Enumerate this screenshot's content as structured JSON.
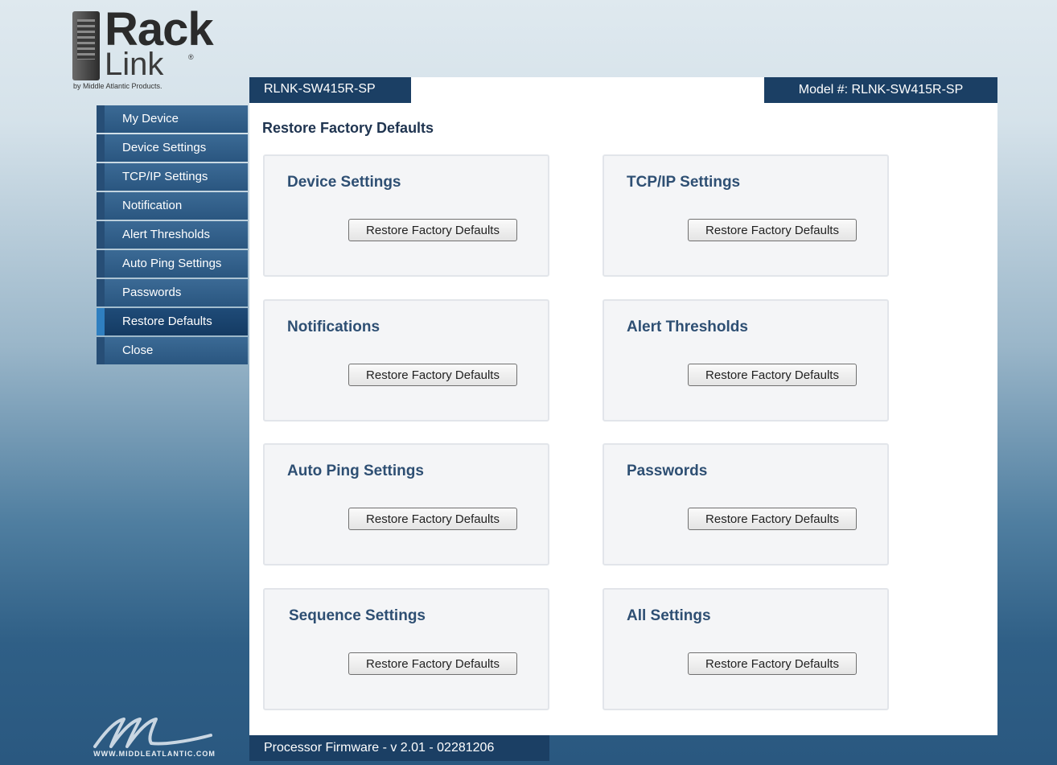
{
  "logo": {
    "rack": "Rack",
    "link": "Link",
    "registered": "®",
    "byline": "by Middle Atlantic Products."
  },
  "sidebar": {
    "items": [
      {
        "label": "My Device"
      },
      {
        "label": "Device Settings"
      },
      {
        "label": "TCP/IP Settings"
      },
      {
        "label": "Notification"
      },
      {
        "label": "Alert Thresholds"
      },
      {
        "label": "Auto Ping Settings"
      },
      {
        "label": "Passwords"
      },
      {
        "label": "Restore Defaults",
        "active": true
      },
      {
        "label": "Close"
      }
    ]
  },
  "header": {
    "device_name": "RLNK-SW415R-SP",
    "model_label": "Model #: RLNK-SW415R-SP"
  },
  "main": {
    "page_title": "Restore Factory Defaults",
    "cards": [
      {
        "title": "Device Settings",
        "button_label": "Restore Factory Defaults"
      },
      {
        "title": "TCP/IP Settings",
        "button_label": "Restore Factory Defaults"
      },
      {
        "title": "Notifications",
        "button_label": "Restore Factory Defaults"
      },
      {
        "title": "Alert Thresholds",
        "button_label": "Restore Factory Defaults"
      },
      {
        "title": "Auto Ping Settings",
        "button_label": "Restore Factory Defaults"
      },
      {
        "title": "Passwords",
        "button_label": "Restore Factory Defaults"
      },
      {
        "title": "Sequence Settings",
        "button_label": "Restore Factory Defaults"
      },
      {
        "title": "All Settings",
        "button_label": "Restore Factory Defaults"
      }
    ]
  },
  "footer": {
    "firmware": "Processor Firmware - v 2.01 - 02281206",
    "url": "WWW.MIDDLEATLANTIC.COM"
  },
  "colors": {
    "nav_bg": "#2a5680",
    "header_bg": "#1b3f64",
    "card_title": "#2e4f73"
  }
}
